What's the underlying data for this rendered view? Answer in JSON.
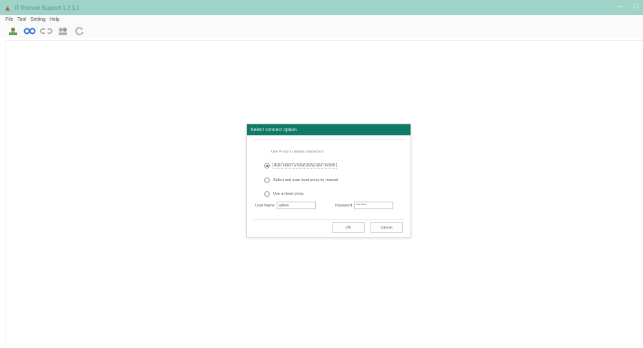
{
  "window": {
    "title": "IT Remote Support 1.2.1.1",
    "minimize": "—",
    "maximize": "☐"
  },
  "menu": [
    "File",
    "Tool",
    "Setting",
    "Help"
  ],
  "toolbar": {
    "icons": [
      "connect-icon",
      "link-icon",
      "unlink-icon",
      "group-icon",
      "refresh-icon"
    ],
    "colors": {
      "blue": "#2e6fd0",
      "gray": "#b0b0b0",
      "green": "#5aa55a"
    }
  },
  "dialog": {
    "title": "Select connect option",
    "proxy_label": "Use Proxy in tested connection",
    "options": [
      "Auto select a local proxy and reconn",
      "Select and scan local proxy by manual",
      "Use a cloud proxy"
    ],
    "selected_option": 0,
    "username_label": "User Name",
    "username_value": "admin",
    "password_label": "Password",
    "password_value": "*******",
    "ok_label": "OK",
    "cancel_label": "Cancel"
  },
  "colors": {
    "titlebar": "#9fd3c7",
    "dialog_header": "#0f7a65"
  }
}
